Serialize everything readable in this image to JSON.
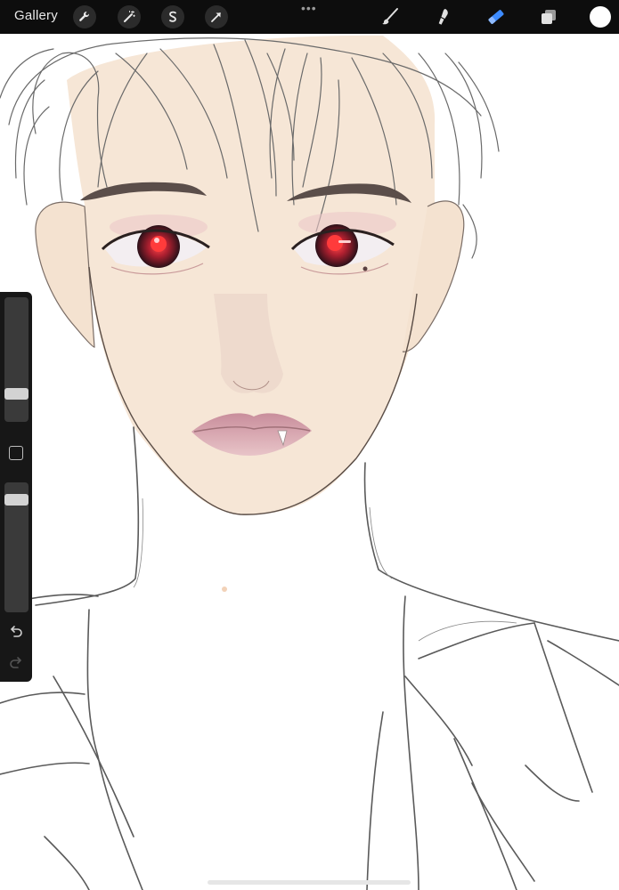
{
  "toolbar": {
    "gallery_label": "Gallery",
    "more_dots": "•••",
    "left_icons": [
      "wrench-icon",
      "magic-wand-icon",
      "selection-icon",
      "transform-arrow-icon"
    ],
    "right_tools": [
      "brush-icon",
      "smudge-icon",
      "eraser-icon",
      "layers-icon"
    ],
    "active_tool": "eraser-icon",
    "active_color": "#3d8bff",
    "current_color": "#ffffff"
  },
  "sidebar": {
    "brush_size": 0.2,
    "brush_opacity": 0.9,
    "controls": [
      "brush-size-slider",
      "modifier-button",
      "opacity-slider",
      "undo-icon",
      "redo-icon"
    ]
  },
  "colors": {
    "skin": "#f6e6d6",
    "iris": "#b02030",
    "lips": "#d9a8b0",
    "sketch": "#5a5a5a"
  }
}
